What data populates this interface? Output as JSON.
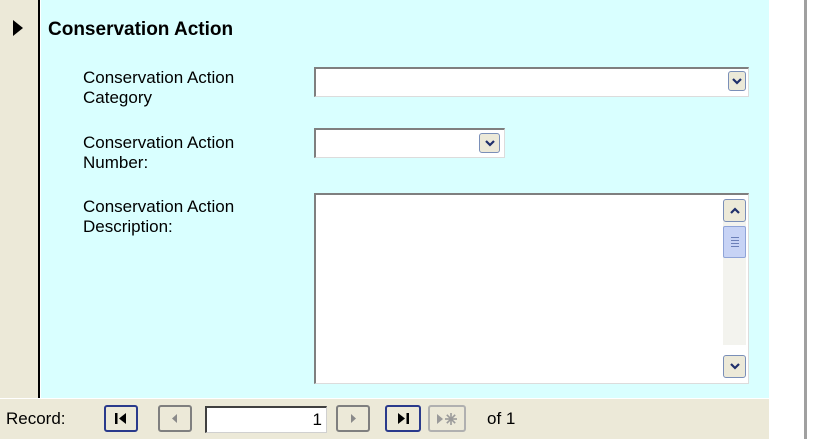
{
  "section": {
    "title": "Conservation Action"
  },
  "fields": {
    "category": {
      "label_line1": "Conservation Action",
      "label_line2": "Category",
      "value": ""
    },
    "number": {
      "label_line1": "Conservation Action",
      "label_line2": "Number:",
      "value": ""
    },
    "description": {
      "label_line1": "Conservation Action",
      "label_line2": "Description:",
      "value": ""
    }
  },
  "navigation": {
    "record_label": "Record:",
    "current_record": "1",
    "of_label": "of",
    "total_records": "1"
  },
  "icons": {
    "record_selector": "record-pointer-icon",
    "dropdown": "chevron-down-icon",
    "scroll_up": "arrow-up-icon",
    "scroll_down": "arrow-down-icon",
    "first": "first-record-icon",
    "previous": "previous-record-icon",
    "next": "next-record-icon",
    "last": "last-record-icon",
    "new": "new-record-icon"
  }
}
